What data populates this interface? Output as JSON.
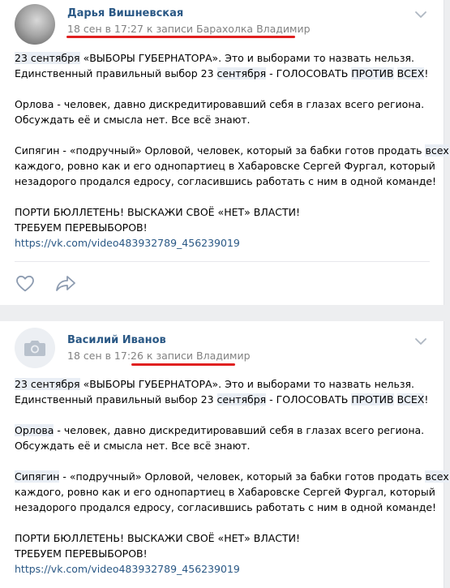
{
  "posts": [
    {
      "author": "Дарья Вишневская",
      "meta": "18 сен в 17:27 к записи Барахолка Владимир",
      "text": {
        "l1a": "23 сентября",
        "l1b": " «ВЫБОРЫ ГУБЕРНАТОРА». Это и выборами то назвать нельзя.",
        "l2a": "Единственный правильный выбор 23 ",
        "l2b": "сентября",
        "l2c": " - ГОЛОСОВАТЬ ",
        "l2d": "ПРОТИВ",
        "l2e": " ",
        "l2f": "ВСЕХ",
        "l2g": "!",
        "l3a": "Орлова",
        "l3b": " - человек, давно дискредитировавший себя в глазах всего региона.",
        "l4": "Обсуждать её и смысла нет. Все всё знают.",
        "l5a": "Сипягин - «подручный» Орловой, человек, который за бабки готов продать ",
        "l5b": "всех",
        "l5c": " и",
        "l6": "каждого, ровно как и его однопартиец в Хабаровске Сергей Фургал, который",
        "l7": "незадорого продался едросу, согласившись работать с ним в одной команде!",
        "l8": "ПОРТИ БЮЛЛЕТЕНЬ! ВЫСКАЖИ СВОЁ «НЕТ» ВЛАСТИ!",
        "l9": "ТРЕБУЕМ ПЕРЕВЫБОРОВ!",
        "link": "https://vk.com/video483932789_456239019"
      }
    },
    {
      "author": "Василий Иванов",
      "meta": "18 сен в 17:26 к записи Владимир",
      "text": {
        "l1a": "23 сентября",
        "l1b": " «ВЫБОРЫ ГУБЕРНАТОРА». Это и выборами то назвать нельзя.",
        "l2a": "Единственный правильный выбор 23 ",
        "l2b": "сентября",
        "l2c": " - ГОЛОСОВАТЬ ",
        "l2d": "ПРОТИВ",
        "l2e": " ",
        "l2f": "ВСЕХ",
        "l2g": "!",
        "l3a": "Орлова",
        "l3b": " - человек, давно дискредитировавший себя в глазах всего региона.",
        "l4": "Обсуждать её и смысла нет. Все всё знают.",
        "l5a": "Сипягин",
        "l5b": " - «подручный» Орловой, человек, который за бабки готов продать ",
        "l5c": "всех",
        "l5d": " и",
        "l6": "каждого, ровно как и его однопартиец в Хабаровске Сергей Фургал, который",
        "l7": "незадорого продался едросу, согласившись работать с ним в одной команде!",
        "l8": "ПОРТИ БЮЛЛЕТЕНЬ! ВЫСКАЖИ СВОЁ «НЕТ» ВЛАСТИ!",
        "l9": "ТРЕБУЕМ ПЕРЕВЫБОРОВ!",
        "link": "https://vk.com/video483932789_456239019"
      }
    }
  ],
  "colors": {
    "accent": "#2a5885",
    "underline": "#e02020",
    "highlight": "#e9eef5"
  },
  "icons": [
    "chevron-down-icon",
    "like-icon",
    "share-icon",
    "camera-icon"
  ]
}
